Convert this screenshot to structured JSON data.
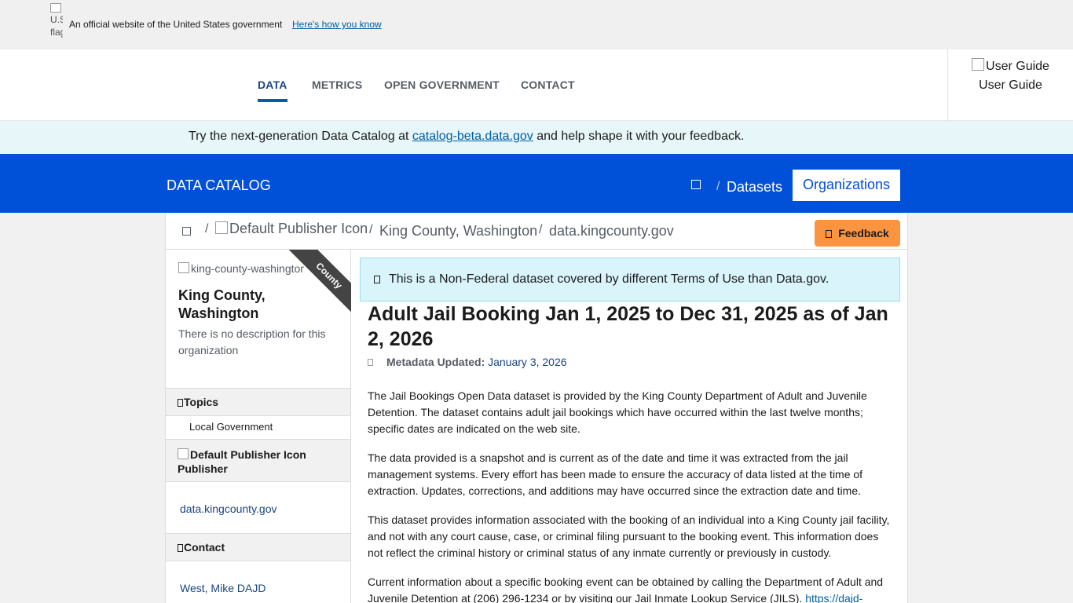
{
  "gov_banner": {
    "flag_alt": "U.S. flag",
    "text": "An official website of the United States government",
    "link": "Here's how you know"
  },
  "nav": {
    "items": [
      {
        "label": "DATA"
      },
      {
        "label": "METRICS"
      },
      {
        "label": "OPEN GOVERNMENT"
      },
      {
        "label": "CONTACT"
      }
    ],
    "active": "DATA",
    "user_guide_alt": "User Guide",
    "user_guide_label": "User Guide"
  },
  "beta_notice": {
    "prefix": "Try the next-generation Data Catalog at ",
    "link": "catalog-beta.data.gov",
    "suffix": " and help shape it with your feedback."
  },
  "catalog_bar": {
    "title": "DATA CATALOG",
    "separator": "/",
    "datasets": "Datasets",
    "organizations": "Organizations",
    "accent": "#0050d8"
  },
  "breadcrumb": {
    "separator": "/",
    "publisher_icon_alt": "Default Publisher Icon",
    "organization": "King County, Washington",
    "dataset": "data.kingcounty.gov"
  },
  "feedback": {
    "label": "Feedback",
    "color": "#fa9441"
  },
  "sidebar": {
    "org_image_alt": "king-county-washington",
    "ribbon": "County",
    "org_name": "King County, Washington",
    "org_description": "There is no description for this organization",
    "topics_heading": "Topics",
    "topics": [
      "Local Government"
    ],
    "publisher_icon_alt": "Default Publisher Icon",
    "publisher_heading": "Publisher",
    "publisher": "data.kingcounty.gov",
    "contact_heading": "Contact",
    "contact": "West, Mike DAJD"
  },
  "main": {
    "alert": "This is a Non-Federal dataset covered by different Terms of Use than Data.gov.",
    "title": "Adult Jail Booking Jan 1, 2025 to Dec 31, 2025 as of Jan 2, 2026",
    "metadata_label": "Metadata Updated:",
    "metadata_date": "January 3, 2026",
    "paragraphs": [
      "The Jail Bookings Open Data dataset is provided by the King County Department of Adult and Juvenile Detention. The dataset contains adult jail bookings which have occurred within the last twelve months; specific dates are indicated on the web site.",
      "The data provided is a snapshot and is current as of the date and time it was extracted from the jail management systems. Every effort has been made to ensure the accuracy of data listed at the time of extraction. Updates, corrections, and additions may have occurred since the extraction date and time.",
      "This dataset provides information associated with the booking of an individual into a King County jail facility, and not with any court cause, case, or criminal filing pursuant to the booking event. This information does not reflect the criminal history or criminal status of any inmate currently or previously in custody."
    ],
    "p4_text": "Current information about a specific booking event can be obtained by calling the Department of Adult and Juvenile Detention at (206) 296-1234 or by visiting our Jail Inmate Lookup Service (JILS). ",
    "p4_link": "https://dajd-"
  }
}
